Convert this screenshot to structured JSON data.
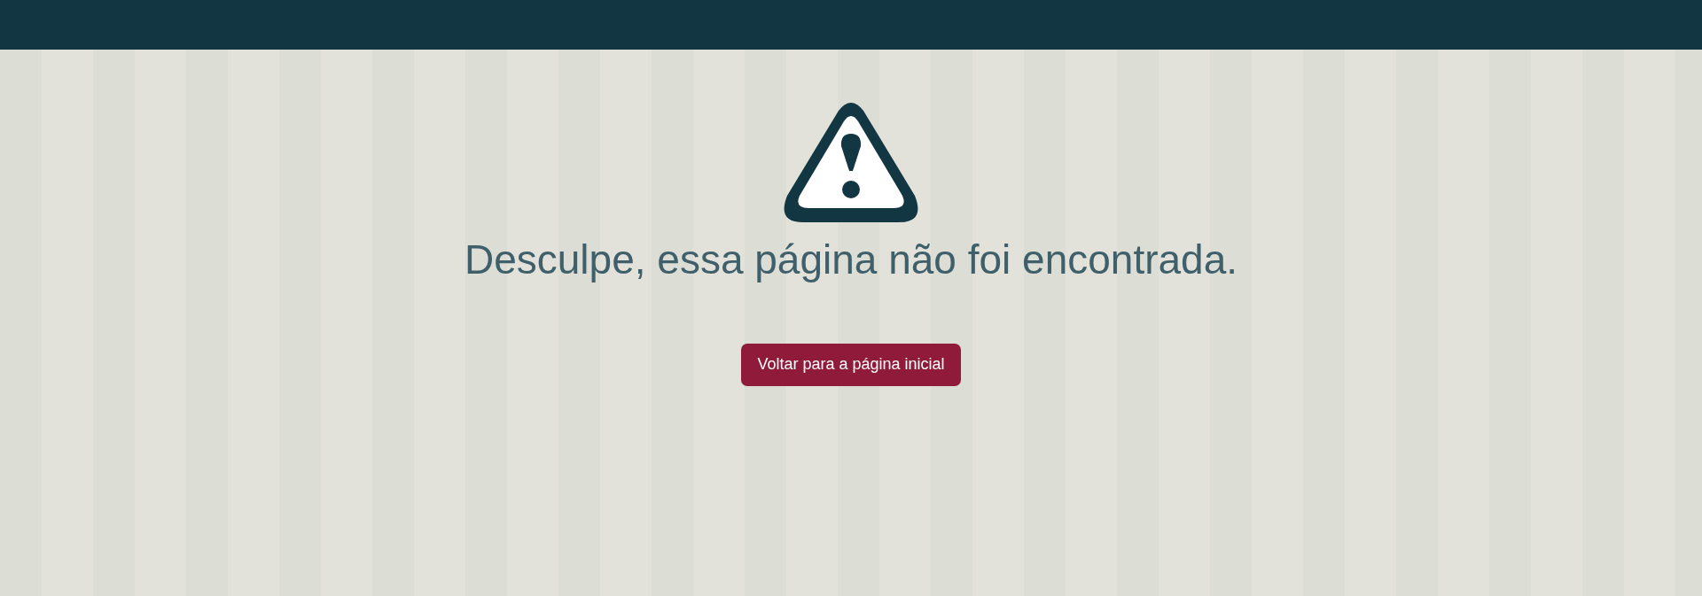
{
  "heading": "Desculpe, essa página não foi encontrada.",
  "button": {
    "label": "Voltar para a página inicial"
  }
}
